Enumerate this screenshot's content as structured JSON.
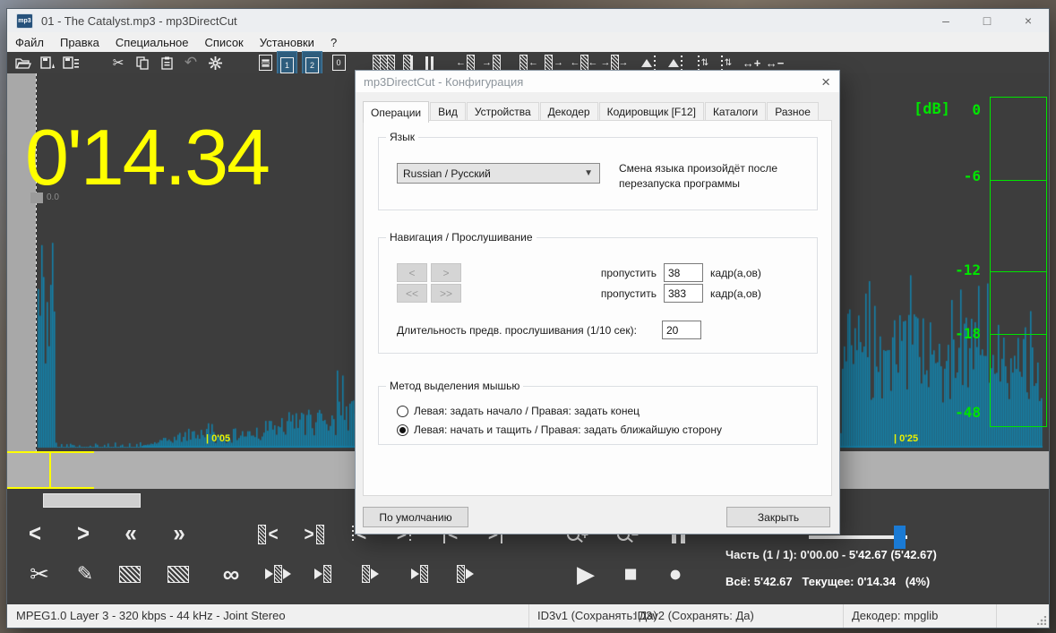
{
  "window": {
    "title": "01 - The Catalyst.mp3 - mp3DirectCut",
    "app_icon_text": "mp3",
    "minimize": "–",
    "maximize": "□",
    "close": "×"
  },
  "menu_bar": {
    "items": [
      "Файл",
      "Правка",
      "Специальное",
      "Список",
      "Установки",
      "?"
    ]
  },
  "wave_view": {
    "time_display": "0'14.34",
    "cursor_label": "0.0",
    "marker_left": "| 0'05",
    "marker_right": "| 0'25",
    "db_scale": {
      "unit": "[dB]",
      "ticks": [
        "0",
        "-6",
        "-12",
        "-18",
        "-48"
      ]
    }
  },
  "transport": {
    "part_info": "Часть (1 / 1): 0'00.00 - 5'42.67 (5'42.67)",
    "totals": "Всё: 5'42.67   Текущее: 0'14.34   (4%)"
  },
  "status_bar": {
    "format_info": "MPEG1.0 Layer 3 - 320 kbps - 44 kHz - Joint Stereo",
    "id3v1": "ID3v1 (Сохранять: Да)",
    "id3v2": "ID3v2 (Сохранять: Да)",
    "decoder": "Декодер: mpglib"
  },
  "dialog": {
    "title": "mp3DirectCut - Конфигурация",
    "close": "×",
    "tabs": [
      {
        "label": "Операции"
      },
      {
        "label": "Вид"
      },
      {
        "label": "Устройства"
      },
      {
        "label": "Декодер"
      },
      {
        "label": "Кодировщик [F12]"
      },
      {
        "label": "Каталоги"
      },
      {
        "label": "Разное"
      }
    ],
    "active_tab": "Операции",
    "language": {
      "group_label": "Язык",
      "selected": "Russian  /  Русский",
      "note1": "Смена языка произойдёт после",
      "note2": "перезапуска программы"
    },
    "navigation": {
      "group_label": "Навигация / Прослушивание",
      "btn_small_back": "<",
      "btn_small_fwd": ">",
      "btn_big_back": "<<",
      "btn_big_fwd": ">>",
      "skip_label": "пропустить",
      "skip_small": "38",
      "skip_big": "383",
      "frames_label": "кадр(а,ов)",
      "prelisten_label": "Длительность предв. прослушивания (1/10 сек):",
      "prelisten_value": "20"
    },
    "mouse": {
      "group_label": "Метод выделения мышью",
      "option1": "Левая: задать начало / Правая: задать конец",
      "option2": "Левая: начать и тащить / Правая: задать ближайшую сторону",
      "selected_option": 2
    },
    "default_button": "По умолчанию",
    "close_button": "Закрыть"
  },
  "colors": {
    "wave": "#1580a8",
    "accent_green": "#00e400",
    "time_yellow": "#ffff00",
    "marker_yellow": "#e9ef00",
    "slider_blue": "#1a7ad4",
    "toolbar_bg": "#3e3e3e",
    "tag_highlight_blue": "#2e5d7d"
  }
}
